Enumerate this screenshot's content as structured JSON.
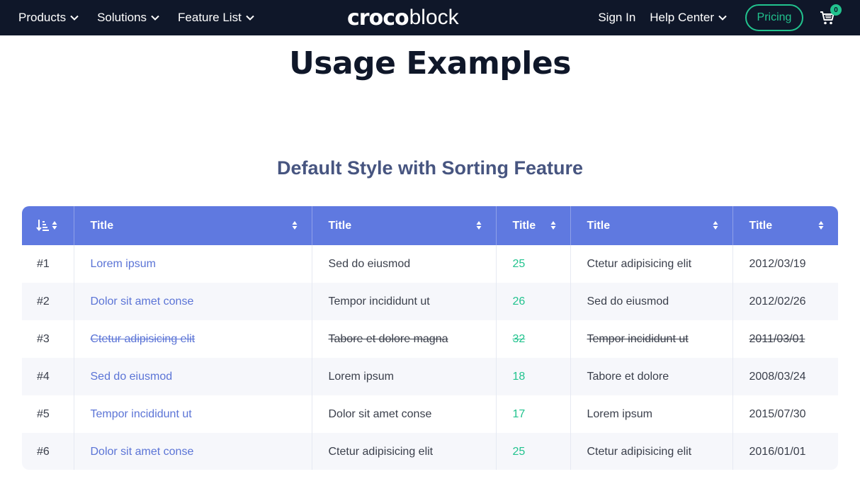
{
  "nav": {
    "items": [
      "Products",
      "Solutions",
      "Feature List"
    ],
    "logo_croco": "croco",
    "logo_block": "block",
    "sign_in": "Sign In",
    "help_center": "Help Center",
    "pricing": "Pricing",
    "cart_count": "0",
    "colors": {
      "bar": "#0f1729",
      "accent": "#22c38e"
    }
  },
  "page_title": "Usage Examples",
  "section_title": "Default Style with Sorting Feature",
  "table": {
    "headers": [
      "",
      "Title",
      "Title",
      "Title",
      "Title",
      "Title"
    ],
    "header_color": "#5f79e0",
    "rows": [
      {
        "index": "#1",
        "c1": "Lorem ipsum",
        "c2": "Sed do eiusmod",
        "c3": "25",
        "c4": "Ctetur adipisicing elit",
        "c5": "2012/03/19",
        "struck": false
      },
      {
        "index": "#2",
        "c1": "Dolor sit amet conse",
        "c2": "Tempor incididunt ut",
        "c3": "26",
        "c4": "Sed do eiusmod",
        "c5": "2012/02/26",
        "struck": false
      },
      {
        "index": "#3",
        "c1": "Ctetur adipisicing elit",
        "c2": "Tabore et dolore magna",
        "c3": "32",
        "c4": "Tempor incididunt ut",
        "c5": "2011/03/01",
        "struck": true
      },
      {
        "index": "#4",
        "c1": "Sed do eiusmod",
        "c2": "Lorem ipsum",
        "c3": "18",
        "c4": "Tabore et dolore",
        "c5": "2008/03/24",
        "struck": false
      },
      {
        "index": "#5",
        "c1": "Tempor incididunt ut",
        "c2": "Dolor sit amet conse",
        "c3": "17",
        "c4": "Lorem ipsum",
        "c5": "2015/07/30",
        "struck": false
      },
      {
        "index": "#6",
        "c1": "Dolor sit amet conse",
        "c2": "Ctetur adipisicing elit",
        "c3": "25",
        "c4": "Ctetur adipisicing elit",
        "c5": "2016/01/01",
        "struck": false
      }
    ]
  }
}
